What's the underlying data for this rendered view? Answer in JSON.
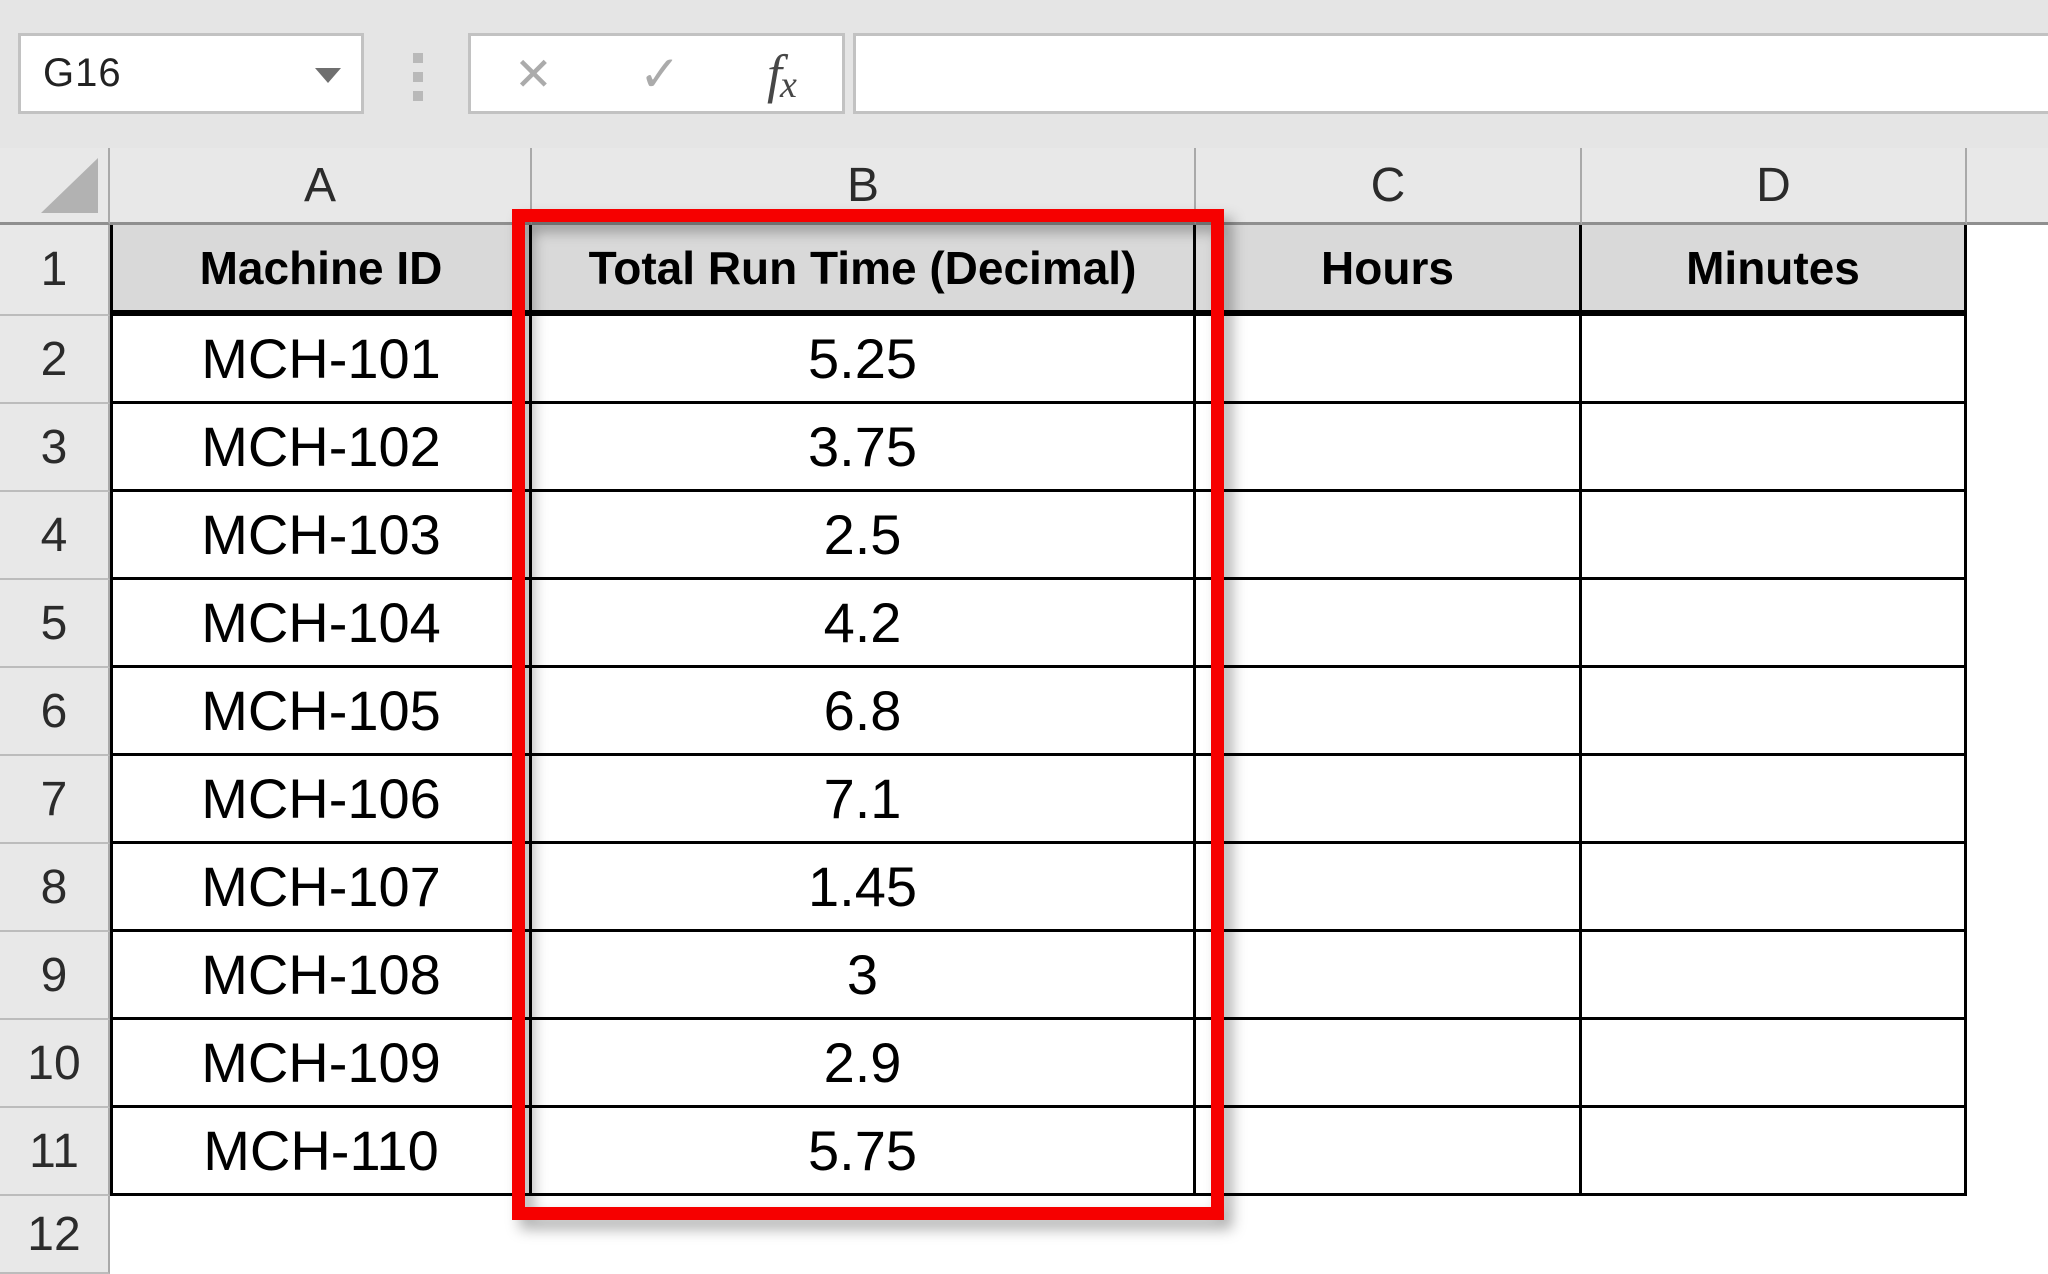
{
  "toolbar": {
    "name_box": "G16",
    "cancel_icon": "✕",
    "enter_icon": "✓",
    "fx_f": "f",
    "fx_x": "x",
    "formula_bar_value": ""
  },
  "sheet": {
    "columns": [
      "A",
      "B",
      "C",
      "D"
    ],
    "row_numbers": [
      "1",
      "2",
      "3",
      "4",
      "5",
      "6",
      "7",
      "8",
      "9",
      "10",
      "11",
      "12"
    ],
    "header_row": [
      "Machine ID",
      "Total Run Time (Decimal)",
      "Hours",
      "Minutes"
    ],
    "rows": [
      {
        "machine_id": "MCH-101",
        "run_time": "5.25",
        "hours": "",
        "minutes": ""
      },
      {
        "machine_id": "MCH-102",
        "run_time": "3.75",
        "hours": "",
        "minutes": ""
      },
      {
        "machine_id": "MCH-103",
        "run_time": "2.5",
        "hours": "",
        "minutes": ""
      },
      {
        "machine_id": "MCH-104",
        "run_time": "4.2",
        "hours": "",
        "minutes": ""
      },
      {
        "machine_id": "MCH-105",
        "run_time": "6.8",
        "hours": "",
        "minutes": ""
      },
      {
        "machine_id": "MCH-106",
        "run_time": "7.1",
        "hours": "",
        "minutes": ""
      },
      {
        "machine_id": "MCH-107",
        "run_time": "1.45",
        "hours": "",
        "minutes": ""
      },
      {
        "machine_id": "MCH-108",
        "run_time": "3",
        "hours": "",
        "minutes": ""
      },
      {
        "machine_id": "MCH-109",
        "run_time": "2.9",
        "hours": "",
        "minutes": ""
      },
      {
        "machine_id": "MCH-110",
        "run_time": "5.75",
        "hours": "",
        "minutes": ""
      }
    ],
    "highlight": {
      "target": "column-B",
      "color": "#f60000"
    }
  },
  "colors": {
    "toolbar_bg": "#e5e5e5",
    "header_strip_bg": "#e8e8e8",
    "table_header_fill": "#d9d9d9",
    "cell_border": "#000000",
    "highlight_red": "#f60000"
  }
}
